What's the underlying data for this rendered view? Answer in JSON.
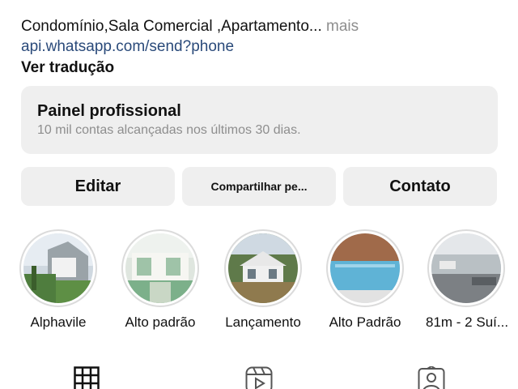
{
  "bio": {
    "line1": "Condomínio,Sala Comercial ,Apartamento...",
    "more": "mais",
    "link": "api.whatsapp.com/send?phone",
    "translate": "Ver tradução"
  },
  "panel": {
    "title": "Painel profissional",
    "subtitle": "10 mil contas alcançadas nos últimos 30 dias."
  },
  "buttons": {
    "edit": "Editar",
    "share": "Compartilhar pe...",
    "contact": "Contato"
  },
  "highlights": [
    {
      "label": "Alphavile"
    },
    {
      "label": "Alto padrão"
    },
    {
      "label": "Lançamento"
    },
    {
      "label": "Alto Padrão"
    },
    {
      "label": "81m - 2 Suí..."
    }
  ],
  "tabs": [
    "grid-icon",
    "reels-icon",
    "tagged-icon"
  ]
}
